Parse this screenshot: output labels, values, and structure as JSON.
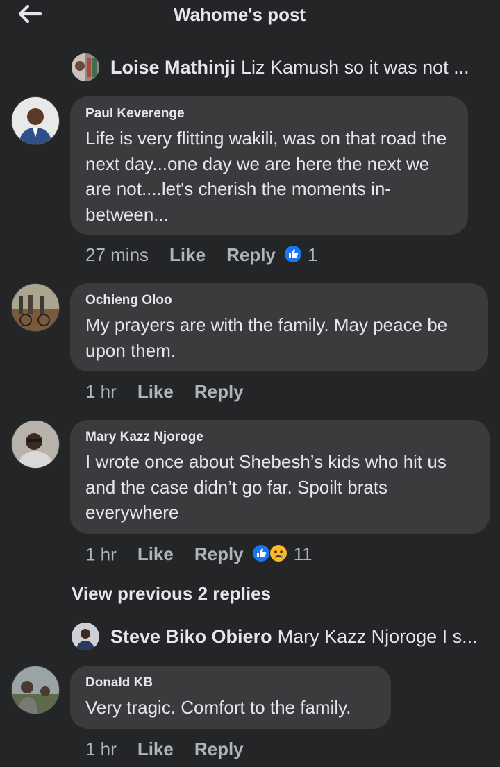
{
  "header": {
    "title": "Wahome's post"
  },
  "reply_preview_1": {
    "name": "Loise Mathinji",
    "text": "Liz Kamush so it was not ..."
  },
  "comments": [
    {
      "author": "Paul Keverenge",
      "text": "Life is very flitting wakili, was on that road the next day...one day we are here the next we are not....let's cherish the moments in-between...",
      "time": "27 mins",
      "like_label": "Like",
      "reply_label": "Reply",
      "reactions": "1"
    },
    {
      "author": "Ochieng Oloo",
      "text": "My prayers are with the family. May peace be upon them.",
      "time": "1 hr",
      "like_label": "Like",
      "reply_label": "Reply"
    },
    {
      "author": "Mary Kazz Njoroge",
      "text": "I wrote once about Shebesh’s kids who hit us and the case didn’t go far. Spoilt brats everywhere",
      "time": "1 hr",
      "like_label": "Like",
      "reply_label": "Reply",
      "reactions": "11"
    },
    {
      "author": "Donald KB",
      "text": "Very tragic. Comfort to the family.",
      "time": "1 hr",
      "like_label": "Like",
      "reply_label": "Reply"
    }
  ],
  "view_previous": "View previous 2 replies",
  "reply_preview_2": {
    "name": "Steve Biko Obiero",
    "text": "Mary Kazz Njoroge I s..."
  },
  "colors": {
    "background": "#242526",
    "bubble": "#3a3b3c",
    "like_blue": "#1877f2",
    "meta_gray": "#b0b3b8"
  },
  "icons": [
    "back-arrow-icon",
    "like-reaction-icon",
    "sad-reaction-icon"
  ]
}
